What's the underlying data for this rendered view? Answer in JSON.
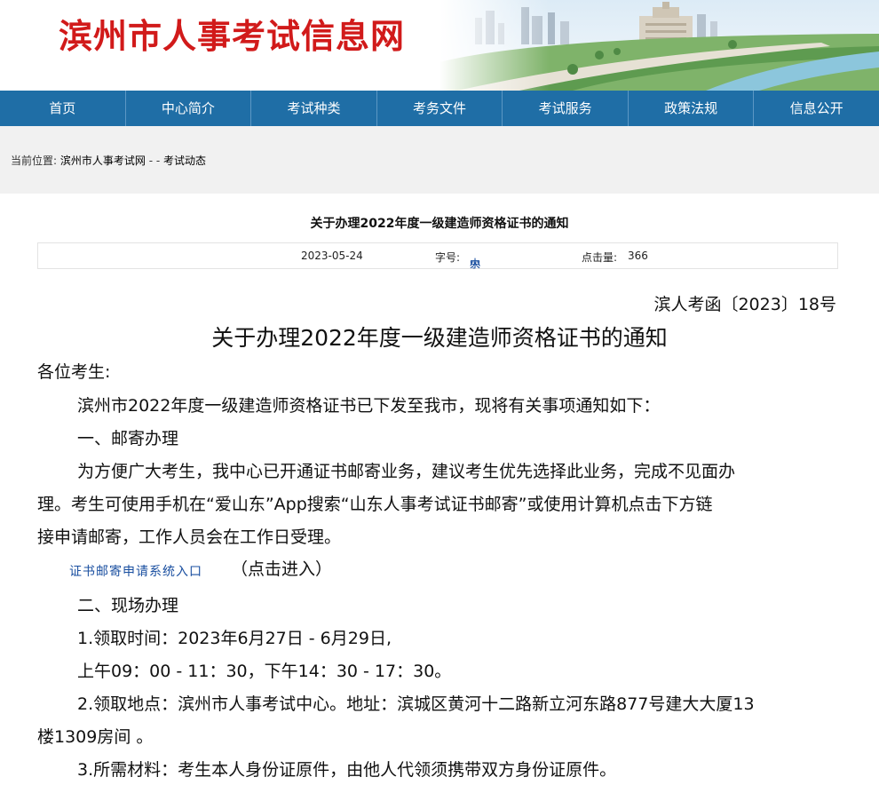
{
  "header": {
    "logo_text": "滨州市人事考试信息网"
  },
  "nav": {
    "items": [
      "首页",
      "中心简介",
      "考试种类",
      "考务文件",
      "考试服务",
      "政策法规",
      "信息公开"
    ]
  },
  "breadcrumb": {
    "prefix": "当前位置:",
    "home": "滨州市人事考试网",
    "sep": "- -",
    "current": "考试动态"
  },
  "article": {
    "title": "关于办理2022年度一级建造师资格证书的通知",
    "date": "2023-05-24",
    "font_size_label": "字号:",
    "font_sizes": [
      "大",
      "中",
      "小"
    ],
    "views_label": "点击量:",
    "views": "366",
    "doc_number": "滨人考函〔2023〕18号",
    "doc_title": "关于办理2022年度一级建造师资格证书的通知",
    "salutation": "各位考生:",
    "intro": "滨州市2022年度一级建造师资格证书已下发至我市，现将有关事项通知如下：",
    "section1_title": "一、邮寄办理",
    "section1_line1": "为方便广大考生，我中心已开通证书邮寄业务，建议考生优先选择此业务，完成不见面办",
    "section1_line2": "理。考生可使用手机在“爱山东”App搜索“山东人事考试证书邮寄”或使用计算机点击下方链",
    "section1_line3": "接申请邮寄，工作人员会在工作日受理。",
    "apply_link": "证书邮寄申请系统入口",
    "apply_hint": "（点击进入）",
    "section2_title": "二、现场办理",
    "time_line1": "1.领取时间：2023年6月27日 - 6月29日,",
    "time_line2": "上午09：00 - 11：30，下午14：30 - 17：30。",
    "place_line1": "2.领取地点：滨州市人事考试中心。地址：滨城区黄河十二路新立河东路877号建大大厦13",
    "place_line2": "楼1309房间 。",
    "materials": "3.所需材料：考生本人身份证原件，由他人代领须携带双方身份证原件。"
  }
}
